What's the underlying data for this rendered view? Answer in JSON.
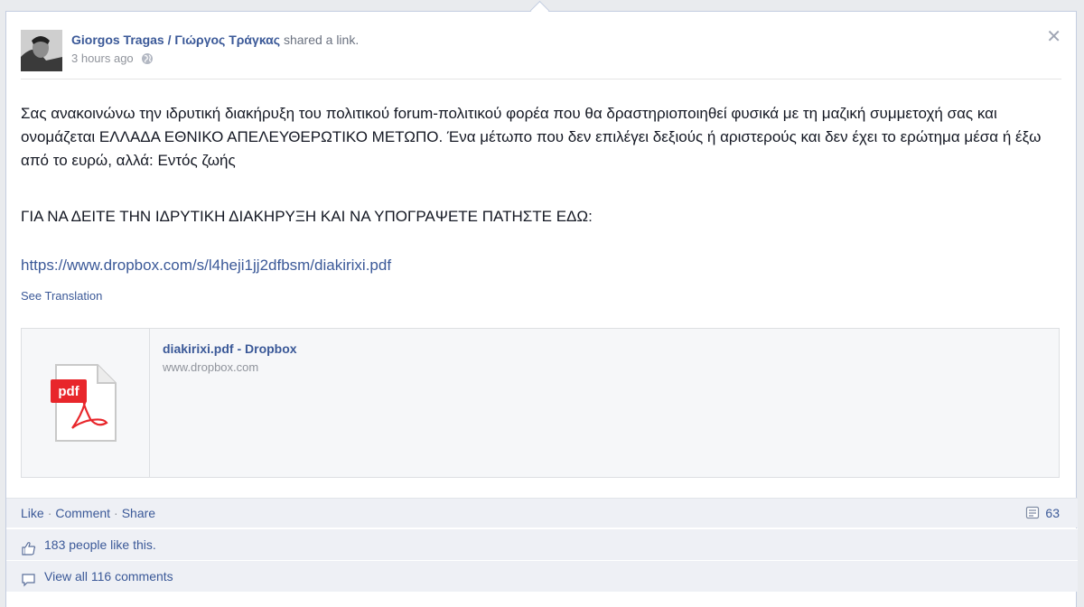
{
  "post": {
    "author": "Giorgos Tragas / Γιώργος Τράγκας",
    "action": "shared a link.",
    "timestamp": "3 hours ago",
    "body": "Σας ανακοινώνω την ιδρυτική διακήρυξη του πολιτικού forum-πολιτικού φορέα που θα δραστηριοποιηθεί φυσικά με τη μαζική συμμετοχή σας και ονομάζεται ΕΛΛΑΔΑ ΕΘΝΙΚΟ ΑΠΕΛΕΥΘΕΡΩΤΙΚΟ ΜΕΤΩΠΟ. Ένα μέτωπο που δεν επιλέγει δεξιούς ή αριστερούς και δεν έχει το ερώτημα μέσα ή έξω από το ευρώ, αλλά: Εντός ζωής",
    "cta": "ΓΙΑ ΝΑ ΔΕΙΤΕ ΤΗΝ ΙΔΡΥΤΙΚΗ ΔΙΑΚΗΡΥΞΗ ΚΑΙ ΝΑ ΥΠΟΓΡΑΨΕΤΕ ΠΑΤΗΣΤΕ ΕΔΩ:",
    "url": "https://www.dropbox.com/s/l4heji1jj2dfbsm/diakirixi.pdf",
    "see_translation": "See Translation"
  },
  "attachment": {
    "title": "diakirixi.pdf - Dropbox",
    "domain": "www.dropbox.com",
    "icon_label": "pdf"
  },
  "actions": {
    "like": "Like",
    "comment": "Comment",
    "share": "Share",
    "comment_count": "63"
  },
  "likes": {
    "text": "183 people like this."
  },
  "comments": {
    "text": "View all 116 comments"
  },
  "colors": {
    "link": "#3b5998",
    "pdf_red": "#e8262b"
  }
}
